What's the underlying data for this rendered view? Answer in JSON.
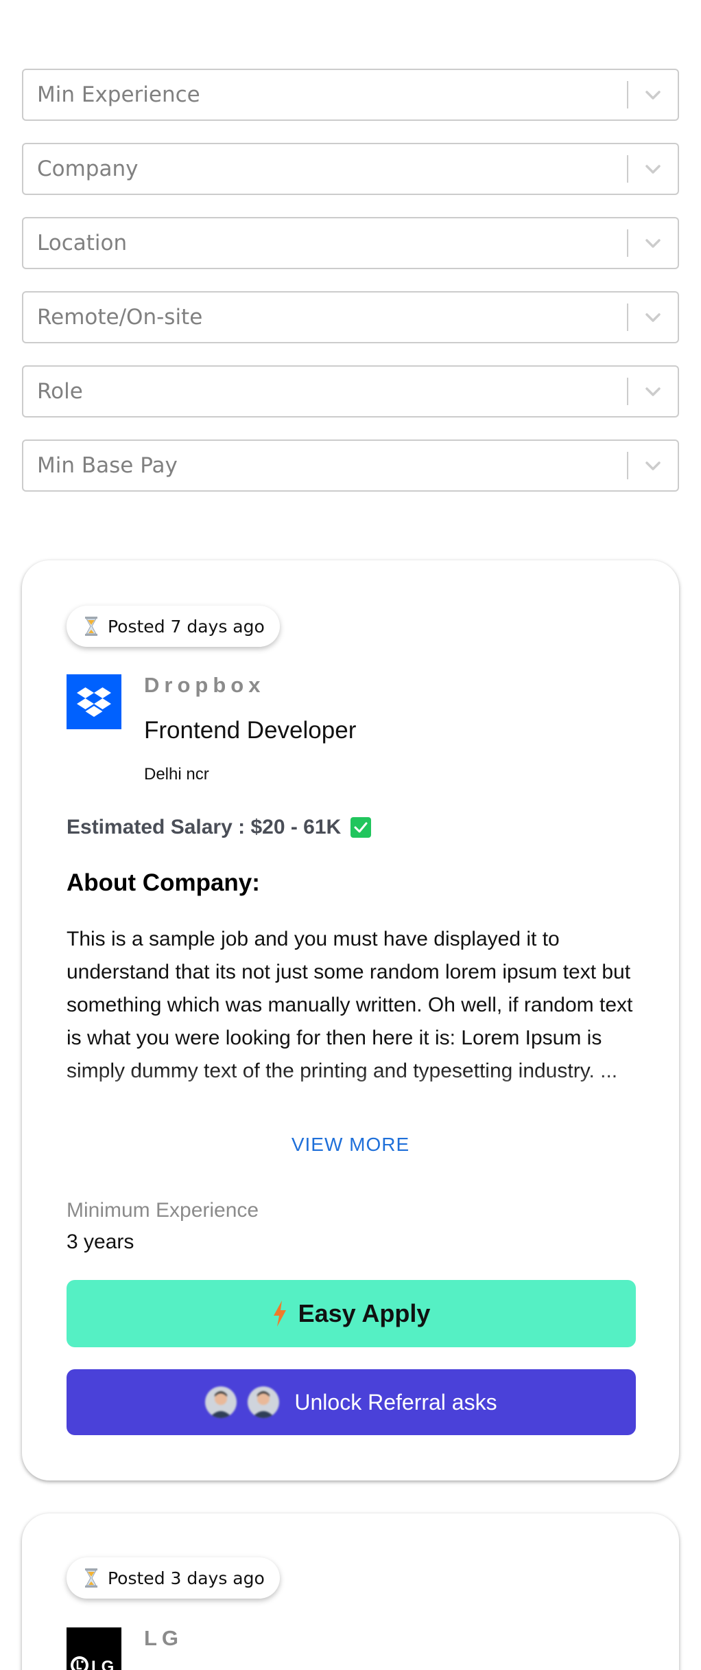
{
  "filters": [
    {
      "placeholder": "Min Experience"
    },
    {
      "placeholder": "Company"
    },
    {
      "placeholder": "Location"
    },
    {
      "placeholder": "Remote/On-site"
    },
    {
      "placeholder": "Role"
    },
    {
      "placeholder": "Min Base Pay"
    }
  ],
  "jobs": [
    {
      "posted": "Posted 7 days ago",
      "company": "Dropbox",
      "logo_icon": "dropbox-logo",
      "logo_color": "#0061fe",
      "role": "Frontend Developer",
      "location": "Delhi ncr",
      "salary": "Estimated Salary : $20 - 61K",
      "about_heading": "About Company:",
      "about_text": "This is a sample job and you must have displayed it to understand that its not just some random lorem ipsum text but something which was manually written. Oh well, if random text is what you were looking for then here it is: Lorem Ipsum is simply dummy text of the printing and typesetting industry. ...",
      "view_more": "VIEW MORE",
      "min_exp_label": "Minimum Experience",
      "min_exp_value": "3 years",
      "easy_apply": "Easy Apply",
      "referral": "Unlock Referral asks"
    },
    {
      "posted": "Posted 3 days ago",
      "company": "LG",
      "logo_icon": "lg-logo",
      "logo_color": "#000000"
    }
  ],
  "colors": {
    "easy_apply_bg": "#55f0c4",
    "referral_bg": "#4a41d9",
    "check_green": "#21c55d",
    "link_blue": "#1e6fd9"
  }
}
